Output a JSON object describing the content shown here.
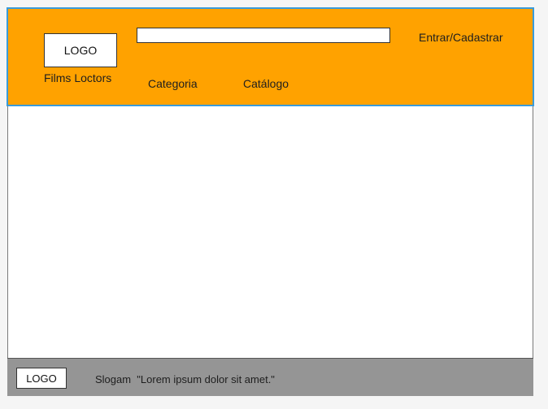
{
  "header": {
    "logo_text": "LOGO",
    "brand_name": "Films Loctors",
    "search_value": "",
    "login_label": "Entrar/Cadastrar",
    "nav": {
      "categoria": "Categoria",
      "catalogo": "Catálogo"
    }
  },
  "footer": {
    "logo_text": "LOGO",
    "slogan": "Slogam  \"Lorem ipsum dolor sit amet.\""
  },
  "colors": {
    "header_bg": "#ffa200",
    "header_border": "#3a9bd9",
    "footer_bg": "#959595",
    "page_bg": "#ffffff"
  }
}
